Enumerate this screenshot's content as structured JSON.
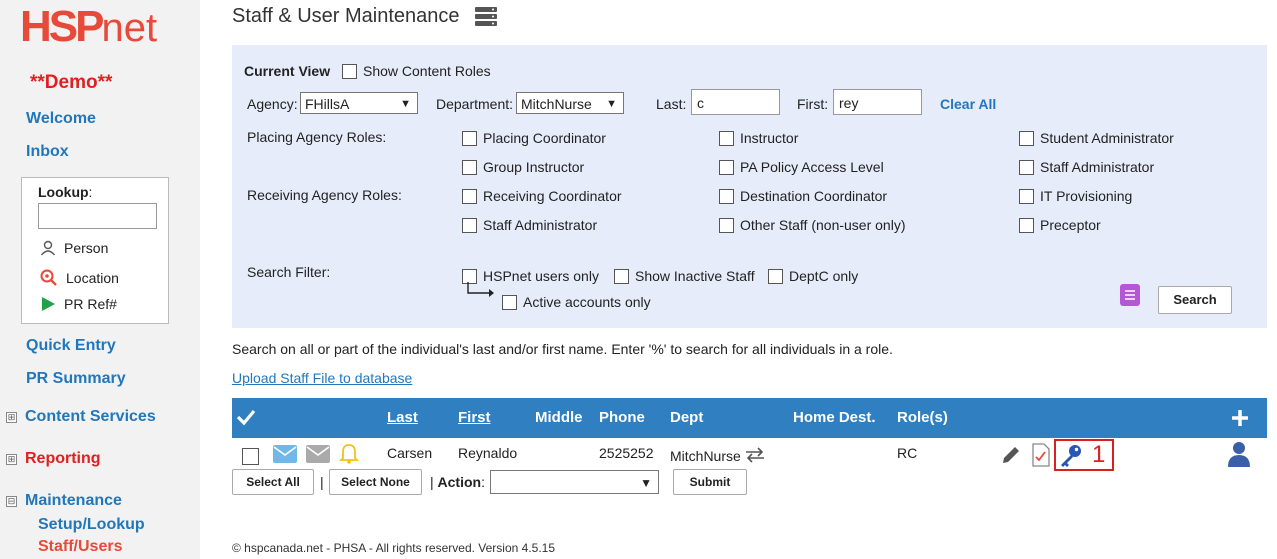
{
  "brand": {
    "logo_hsp": "HSP",
    "logo_net": "net",
    "demo": "**Demo**"
  },
  "sidebar": {
    "welcome": "Welcome",
    "inbox": "Inbox",
    "lookup": {
      "label": "Lookup",
      "colon": ":",
      "value": "",
      "person": "Person",
      "location": "Location",
      "pr_ref": "PR Ref#"
    },
    "quick_entry": "Quick Entry",
    "pr_summary": "PR Summary",
    "content_services": "Content Services",
    "reporting": "Reporting",
    "maintenance": "Maintenance",
    "setup_lookup": "Setup/Lookup",
    "staff_users": "Staff/Users",
    "expand_glyph": "⊞",
    "collapse_glyph": "⊟"
  },
  "page": {
    "title": "Staff & User Maintenance"
  },
  "filters": {
    "current_view": "Current View",
    "show_content_roles": "Show Content Roles",
    "agency_label": "Agency:",
    "agency_value": "FHillsA",
    "department_label": "Department:",
    "department_value": "MitchNurse",
    "last_label": "Last:",
    "last_value": "c",
    "first_label": "First:",
    "first_value": "rey",
    "clear_all": "Clear All",
    "placing_roles_label": "Placing Agency Roles:",
    "receiving_roles_label": "Receiving Agency Roles:",
    "placing_roles": [
      "Placing Coordinator",
      "Instructor",
      "Student Administrator",
      "Group Instructor",
      "PA Policy Access Level",
      "Staff Administrator"
    ],
    "receiving_roles": [
      "Receiving Coordinator",
      "Destination Coordinator",
      "IT Provisioning",
      "Staff Administrator",
      "Other Staff (non-user only)",
      "Preceptor"
    ],
    "search_filter_label": "Search Filter:",
    "hspnet_users_only": "HSPnet users only",
    "show_inactive": "Show Inactive Staff",
    "deptc_only": "DeptC only",
    "active_only": "Active accounts only",
    "search_button": "Search"
  },
  "help_text": "Search on all or part of the individual's last and/or first name. Enter '%' to search for all individuals in a role.",
  "upload_link": "Upload Staff File to database",
  "table": {
    "headers": {
      "last": "Last",
      "first": "First",
      "middle": "Middle",
      "phone": "Phone",
      "dept": "Dept",
      "home_dest": "Home Dest.",
      "roles": "Role(s)"
    },
    "rows": [
      {
        "last": "Carsen",
        "first": "Reynaldo",
        "middle": "",
        "phone": "2525252",
        "dept": "MitchNurse",
        "home_dest": "",
        "roles": "RC"
      }
    ]
  },
  "annotation": "1",
  "actions": {
    "select_all": "Select All",
    "select_none": "Select None",
    "sep1": "|",
    "sep2": "|",
    "action_label": "Action",
    "action_colon": ":",
    "action_value": "",
    "submit": "Submit"
  },
  "footer": "© hspcanada.net - PHSA - All rights reserved.    Version 4.5.15",
  "colors": {
    "accent": "#2f7fc1",
    "brand": "#e84a3a",
    "panel": "#e6ecfa"
  }
}
